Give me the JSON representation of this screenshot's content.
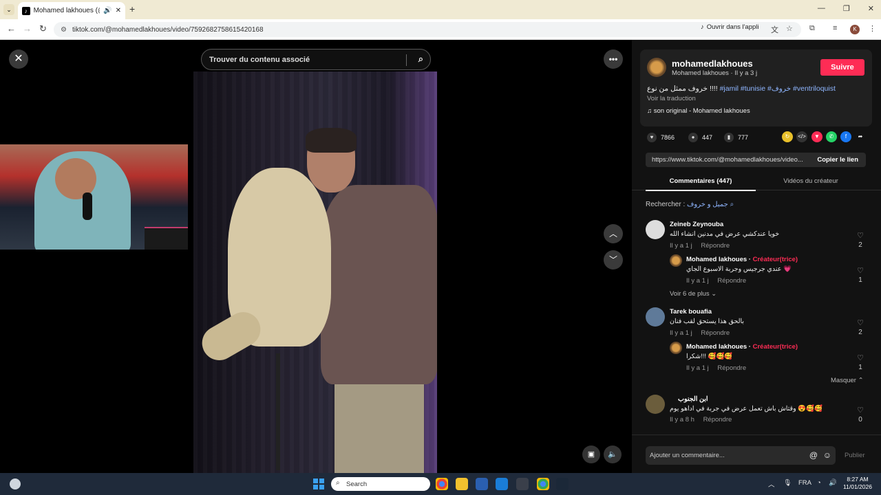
{
  "browser": {
    "tab_title": "Mohamed lakhoues (@mo",
    "url": "tiktok.com/@mohamedlakhoues/video/7592682758615420168",
    "open_app_label": "Ouvrir dans l'appli",
    "profile_letter": "K"
  },
  "stage": {
    "search_placeholder": "Trouver du contenu associé"
  },
  "post": {
    "username": "mohamedlakhoues",
    "subtitle": "Mohamed lakhoues · Il y a 3 j",
    "follow_label": "Suivre",
    "caption_arabic": "خروف ممثل من نوع !!!!",
    "hashtags": "#jamil #tunisie #خروف #ventriloquist",
    "translate_label": "Voir la traduction",
    "sound": "♫  son original - Mohamed lakhoues",
    "likes": "7866",
    "comments_count": "447",
    "saves": "777",
    "link": "https://www.tiktok.com/@mohamedlakhoues/video...",
    "copy_label": "Copier le lien"
  },
  "tabs": {
    "comments": "Commentaires (447)",
    "creator_videos": "Vidéos du créateur"
  },
  "search_suggestion": {
    "label": "Rechercher : ",
    "query": "جميل و خروف"
  },
  "comments": [
    {
      "name": "Zeineb Zeynouba",
      "text": "خويا عندكشي عرض في مدنين انشاء الله",
      "time": "Il y a 1 j",
      "reply_label": "Répondre",
      "likes": "2",
      "reply": {
        "name": "Mohamed lakhoues · ",
        "badge": "Créateur(trice)",
        "text": "عندي جرجيس وجربة الاسبوع الجاي 💗",
        "time": "Il y a 1 j",
        "reply_label": "Répondre",
        "likes": "1"
      },
      "more": "Voir 6 de plus ⌄"
    },
    {
      "name": "Tarek bouafia",
      "text": "بالحق هذا يستحق لقب فنان",
      "time": "Il y a 1 j",
      "reply_label": "Répondre",
      "likes": "2",
      "reply": {
        "name": "Mohamed lakhoues · ",
        "badge": "Créateur(trice)",
        "text": "شكرا!!! 🥰🥰🥰",
        "time": "Il y a 1 j",
        "reply_label": "Répondre",
        "likes": "1"
      },
      "hide": "Masquer ⌃"
    },
    {
      "name": "ابن الجنوب",
      "text": "وقتاش باش تعمل عرض في جربة في اداهو يوم 😍🥰🥰",
      "time": "Il y a 8 h",
      "reply_label": "Répondre",
      "likes": "0"
    }
  ],
  "composer": {
    "placeholder": "Ajouter un commentaire...",
    "publish_label": "Publier"
  },
  "taskbar": {
    "search_label": "Search",
    "lang": "FRA",
    "time": "8:27 AM",
    "date": "11/01/2026"
  },
  "colors": {
    "accent": "#fe2c55",
    "hashtag": "#8fb6ff",
    "panel_bg": "#121212"
  }
}
